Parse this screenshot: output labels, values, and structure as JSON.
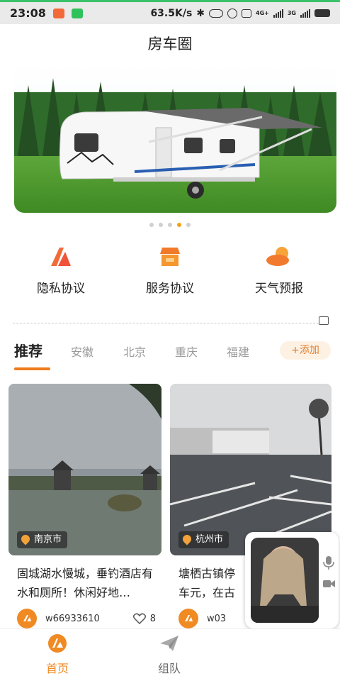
{
  "status_bar": {
    "time": "23:08",
    "speed": "63.5K/s",
    "network_tag_1": "4G+",
    "network_tag_2": "3G"
  },
  "header": {
    "title": "房车圈"
  },
  "quick_entries": [
    {
      "label": "隐私协议",
      "icon": "privacy-icon"
    },
    {
      "label": "服务协议",
      "icon": "service-icon"
    },
    {
      "label": "天气预报",
      "icon": "weather-icon"
    }
  ],
  "tabs": {
    "items": [
      "推荐",
      "安徽",
      "北京",
      "重庆",
      "福建"
    ],
    "active": "推荐",
    "add_label": "+添加"
  },
  "cards": [
    {
      "location": "南京市",
      "title": "固城湖水慢城，垂钓酒店有水和厕所！休闲好地…",
      "user": "w66933610",
      "likes": "8"
    },
    {
      "location": "杭州市",
      "title": "塘栖古镇停车元，在古运河",
      "user": "w03"
    }
  ],
  "bottom_nav": [
    {
      "label": "首页",
      "icon": "home-icon",
      "active": true
    },
    {
      "label": "组队",
      "icon": "team-icon",
      "active": false
    }
  ],
  "colors": {
    "accent": "#f08a23",
    "tab_underline": "#f07b1c",
    "active_dot": "#f1a21b"
  }
}
